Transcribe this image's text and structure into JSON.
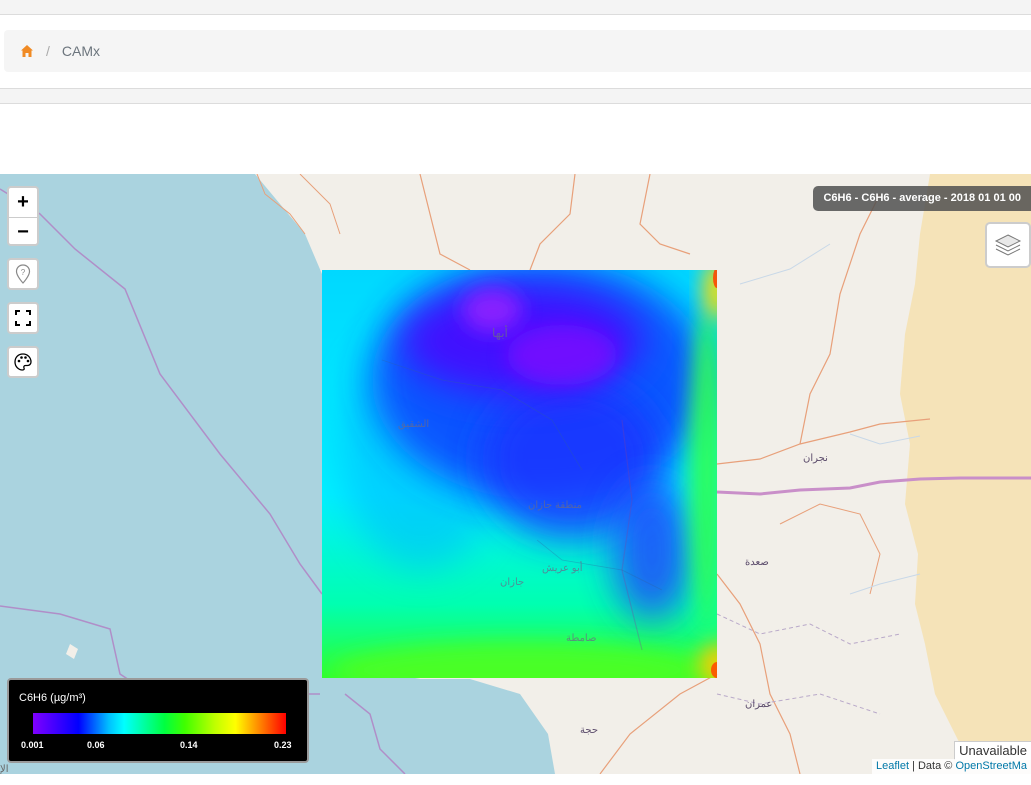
{
  "breadcrumb": {
    "home_icon": "home-icon",
    "separator": "/",
    "current": "CAMx"
  },
  "map": {
    "layer_info": "C6H6 - C6H6 - average - 2018 01 01 00",
    "zoom_in": "+",
    "zoom_out": "−",
    "controls": [
      "locate-icon",
      "fullscreen-icon",
      "palette-icon",
      "layers-icon"
    ],
    "places": [
      {
        "id": "abha",
        "name": "أبها"
      },
      {
        "id": "shuqaiq",
        "name": "الشقيق"
      },
      {
        "id": "najran",
        "name": "نجران"
      },
      {
        "id": "jazan_region",
        "name": "منطقة جازان"
      },
      {
        "id": "abu_arish",
        "name": "أبو عريش"
      },
      {
        "id": "jazan",
        "name": "جازان"
      },
      {
        "id": "saada",
        "name": "صعدة"
      },
      {
        "id": "samtah",
        "name": "صامطة"
      },
      {
        "id": "amran",
        "name": "عمران"
      },
      {
        "id": "hajjah",
        "name": "حجة"
      }
    ],
    "unavailable_text": "Unavailable",
    "attribution": {
      "leaflet": "Leaflet",
      "sep": " | Data © ",
      "osm": "OpenStreetMa"
    },
    "bottom_left_fragment": "الإ"
  },
  "legend": {
    "title": "C6H6 (µg/m³)",
    "ticks": [
      "0.001",
      "0.06",
      "0.14",
      "0.23"
    ],
    "colors": [
      "#8000ff",
      "#0000ff",
      "#00ffff",
      "#00ff00",
      "#ffff00",
      "#ff0000"
    ]
  }
}
